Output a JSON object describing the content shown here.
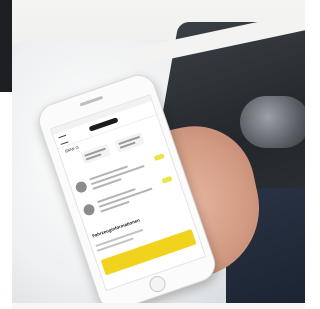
{
  "scene": {
    "description_tag": "",
    "phone_app": {
      "header_logo": "logo-mark",
      "model_label": "BMW i3",
      "section_title": "Fahrzeuginformationen"
    },
    "colors": {
      "accent_yellow": "#f1d21c",
      "sleeve_navy": "#1a2230",
      "nail_red": "#c8383b"
    }
  }
}
